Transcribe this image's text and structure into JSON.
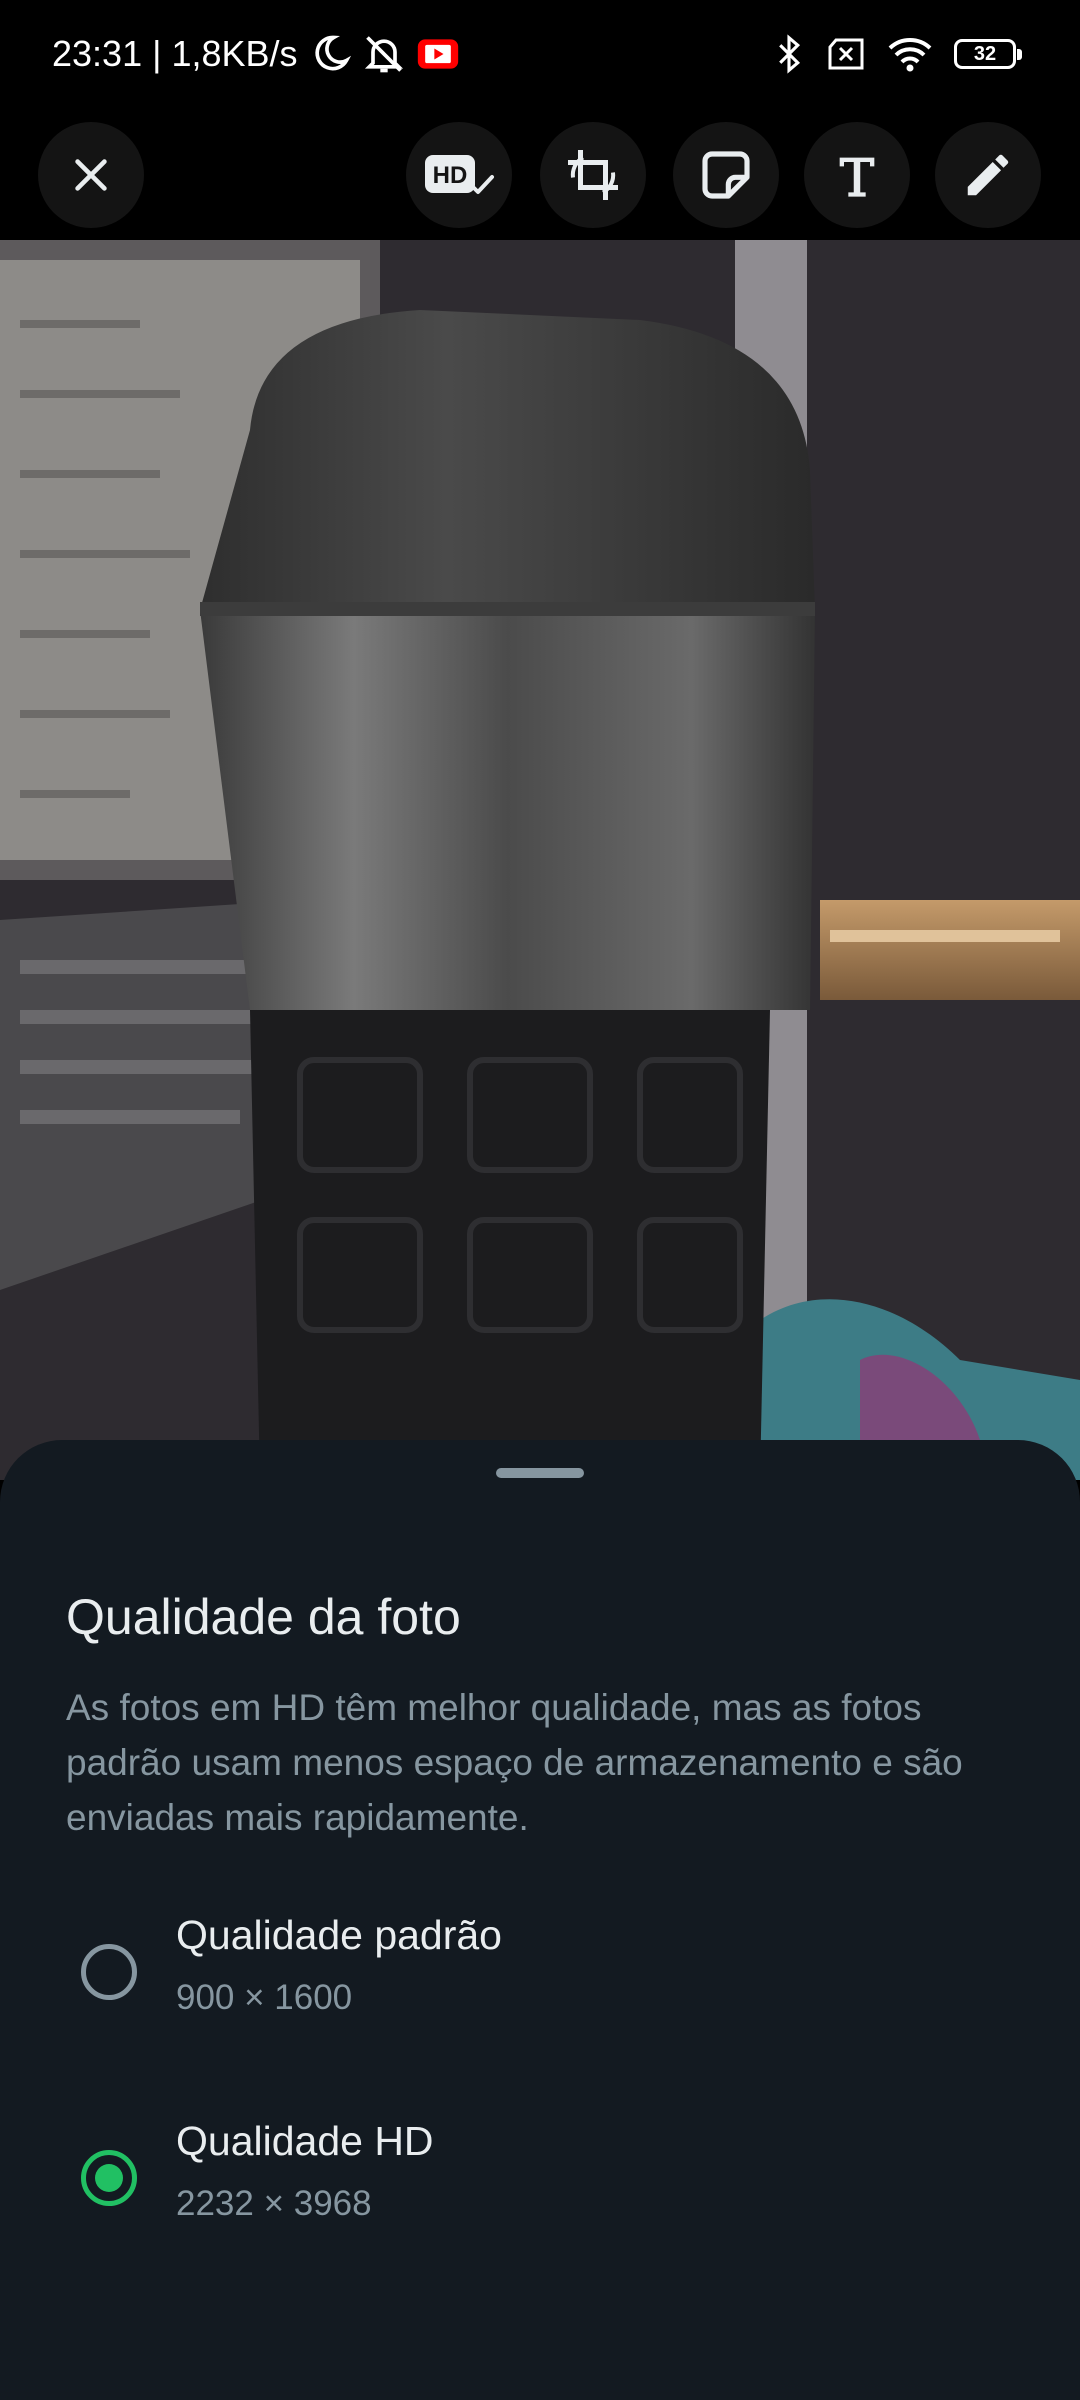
{
  "status_bar": {
    "time_speed": "23:31 | 1,8KB/s",
    "battery_level": "32",
    "left_icons": [
      "moon-icon",
      "muted-bell-icon",
      "youtube-icon"
    ],
    "right_icons": [
      "bluetooth-icon",
      "no-sim-icon",
      "wifi-icon",
      "battery-icon"
    ]
  },
  "toolbar": {
    "close_icon": "close-icon",
    "tools": [
      "hd-quality-icon",
      "crop-rotate-icon",
      "sticker-icon",
      "text-icon",
      "pencil-icon"
    ]
  },
  "sheet": {
    "title": "Qualidade da foto",
    "description": "As fotos em HD têm melhor qualidade, mas as fotos padrão usam menos espaço de armazenamento e são enviadas mais rapidamente.",
    "options": [
      {
        "label": "Qualidade padrão",
        "resolution": "900 × 1600",
        "selected": false
      },
      {
        "label": "Qualidade HD",
        "resolution": "2232 × 3968",
        "selected": true
      }
    ]
  },
  "colors": {
    "accent": "#21c063",
    "sheet_bg": "#131a21",
    "primary_text": "#e9edef",
    "secondary_text": "#8696a0"
  }
}
